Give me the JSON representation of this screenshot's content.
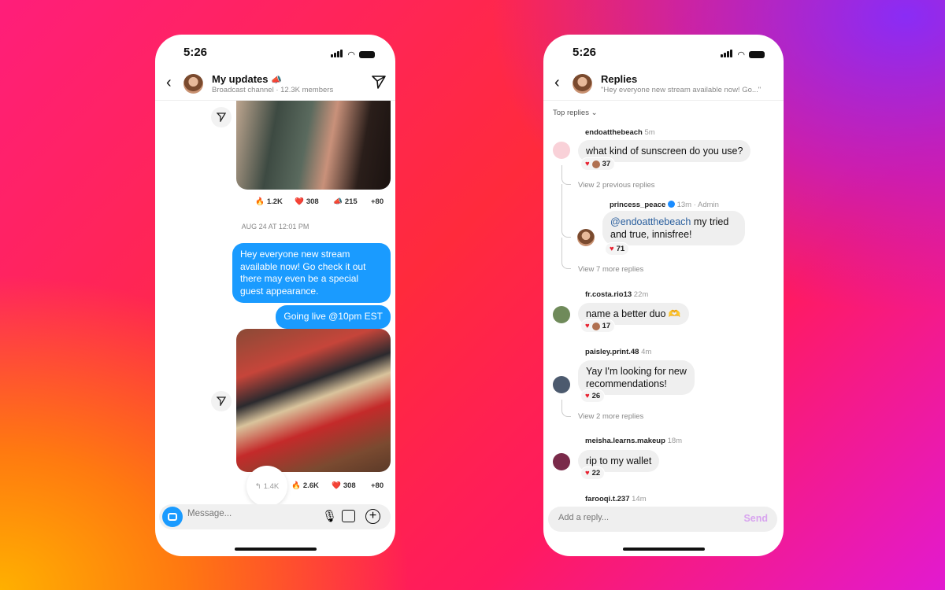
{
  "left": {
    "status_time": "5:26",
    "header": {
      "title": "My updates",
      "title_emoji": "📣",
      "subtitle": "Broadcast channel · 12.3K members"
    },
    "reactions_1": [
      {
        "emoji": "🔥",
        "count": "1.2K"
      },
      {
        "emoji": "❤️",
        "count": "308"
      },
      {
        "emoji": "📣",
        "count": "215"
      },
      {
        "emoji": "",
        "count": "+80"
      }
    ],
    "timestamp": "AUG 24 AT 12:01 PM",
    "messages": [
      "Hey everyone new stream available now! Go check it out there may even be a special guest appearance.",
      "Going live @10pm EST"
    ],
    "reply_count": "1.4K",
    "reactions_2": [
      {
        "emoji": "🔥",
        "count": "2.6K"
      },
      {
        "emoji": "❤️",
        "count": "308"
      },
      {
        "emoji": "",
        "count": "+80"
      }
    ],
    "composer": {
      "placeholder": "Message..."
    }
  },
  "right": {
    "status_time": "5:26",
    "header": {
      "title": "Replies",
      "subtitle": "\"Hey everyone new stream available now! Go...\""
    },
    "sort": "Top replies",
    "replies": [
      {
        "user": "endoatthebeach",
        "time": "5m",
        "text": "what kind of sunscreen do you use?",
        "reactions": "37"
      },
      {
        "user": "princess_peace",
        "time": "13m · Admin",
        "mention": "@endoatthebeach",
        "text": " my tried and true, innisfree!",
        "reactions": "71"
      },
      {
        "user": "fr.costa.rio13",
        "time": "22m",
        "text": "name a better duo 🫶",
        "reactions": "17"
      },
      {
        "user": "paisley.print.48",
        "time": "4m",
        "text": "Yay I'm looking for new recommendations!",
        "reactions": "26"
      },
      {
        "user": "meisha.learns.makeup",
        "time": "18m",
        "text": "rip to my wallet",
        "reactions": "22"
      },
      {
        "user": "farooqi.t.237",
        "time": "14m"
      }
    ],
    "view_links": [
      "View 2 previous replies",
      "View 7 more replies",
      "View 2 more replies"
    ],
    "composer": {
      "placeholder": "Add a reply...",
      "send": "Send"
    },
    "colors": {
      "send": "#d8a4ef",
      "mention": "#2a5f9e"
    }
  }
}
